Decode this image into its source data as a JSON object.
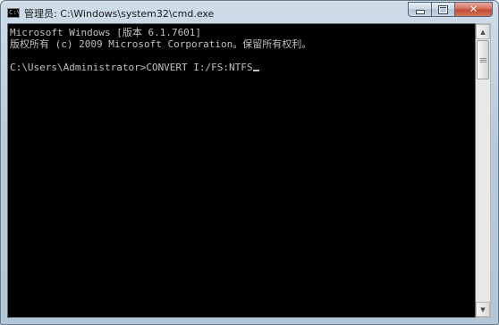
{
  "window": {
    "title": "管理员: C:\\Windows\\system32\\cmd.exe",
    "app_icon_text": "C:\\"
  },
  "caption_buttons": {
    "minimize": "minimize-icon",
    "maximize": "maximize-icon",
    "close": "close-icon",
    "close_glyph": "✕"
  },
  "console": {
    "lines": [
      "Microsoft Windows [版本 6.1.7601]",
      "版权所有 (c) 2009 Microsoft Corporation。保留所有权利。",
      "",
      "C:\\Users\\Administrator>CONVERT I:/FS:NTFS"
    ],
    "text_color": "#c0c0c0",
    "background": "#000000"
  },
  "scrollbar": {
    "up_glyph": "▲",
    "down_glyph": "▼"
  }
}
